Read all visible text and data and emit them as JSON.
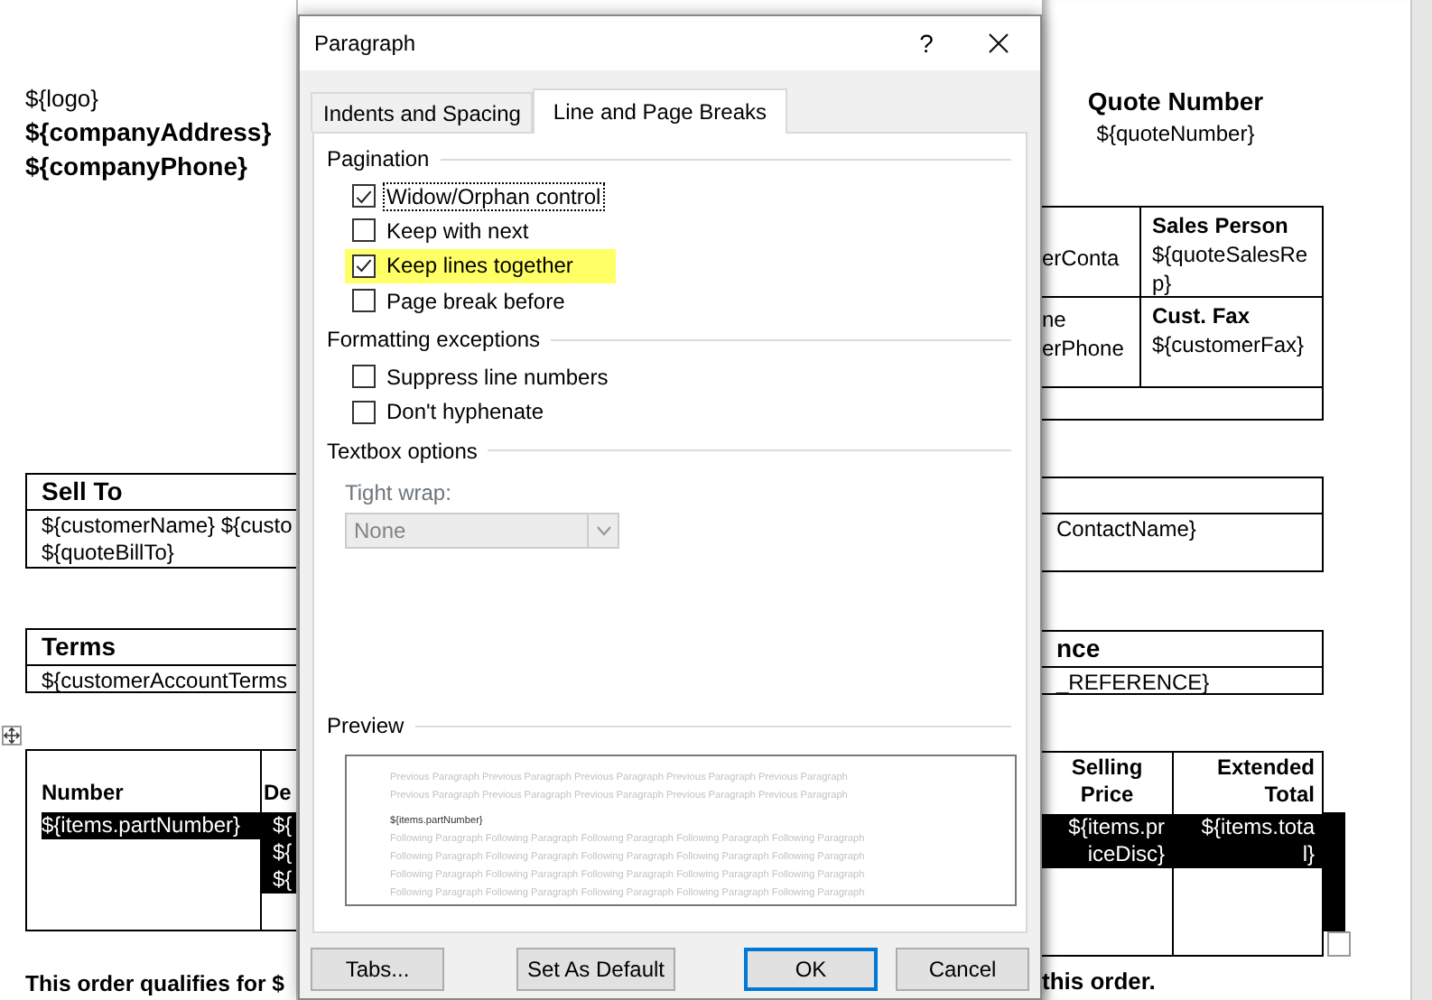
{
  "doc_left": {
    "company": [
      {
        "text": "${logo}",
        "bold": false
      },
      {
        "text": "${companyAddress}",
        "bold": true
      },
      {
        "text": "${companyPhone}",
        "bold": true
      }
    ],
    "sell_to_table": {
      "header": "Sell To",
      "lines": [
        "${customerName}  ${custo",
        "${quoteBillTo}"
      ]
    },
    "terms_table": {
      "header": "Terms",
      "lines": [
        "${customerAccountTerms"
      ]
    },
    "items_table": {
      "columns": [
        "Number",
        "De"
      ],
      "rows": [
        {
          "selected": true,
          "cells": [
            [
              "${items.partNumber}"
            ],
            [
              "${",
              "${",
              "${"
            ]
          ]
        }
      ]
    },
    "footer": "This order qualifies for $"
  },
  "dialog": {
    "title": "Paragraph",
    "help": "?",
    "tabs": [
      {
        "label": "Indents and Spacing",
        "selected": false
      },
      {
        "label": "Line and Page Breaks",
        "selected": true
      }
    ],
    "groups": [
      {
        "title": "Pagination",
        "options": [
          {
            "label": "Widow/Orphan control",
            "checked": true,
            "focused": true,
            "highlighted": false
          },
          {
            "label": "Keep with next",
            "checked": false,
            "focused": false,
            "highlighted": false
          },
          {
            "label": "Keep lines together",
            "checked": true,
            "focused": false,
            "highlighted": true
          },
          {
            "label": "Page break before",
            "checked": false,
            "focused": false,
            "highlighted": false
          }
        ]
      },
      {
        "title": "Formatting exceptions",
        "options": [
          {
            "label": "Suppress line numbers",
            "checked": false,
            "focused": false,
            "highlighted": false
          },
          {
            "label": "Don't hyphenate",
            "checked": false,
            "focused": false,
            "highlighted": false
          }
        ]
      }
    ],
    "textbox_options": {
      "title": "Textbox options",
      "label": "Tight wrap:",
      "value": "None",
      "disabled": true
    },
    "preview": {
      "title": "Preview",
      "previous": [
        "Previous Paragraph Previous Paragraph Previous Paragraph Previous Paragraph Previous Paragraph",
        "Previous Paragraph Previous Paragraph Previous Paragraph Previous Paragraph Previous Paragraph"
      ],
      "current": "${items.partNumber}",
      "following": [
        "Following Paragraph Following Paragraph Following Paragraph Following Paragraph Following Paragraph",
        "Following Paragraph Following Paragraph Following Paragraph Following Paragraph Following Paragraph",
        "Following Paragraph Following Paragraph Following Paragraph Following Paragraph Following Paragraph",
        "Following Paragraph Following Paragraph Following Paragraph Following Paragraph Following Paragraph"
      ]
    },
    "buttons": [
      {
        "label": "Tabs...",
        "default": false
      },
      {
        "label": "Set As Default",
        "default": false
      },
      {
        "label": "OK",
        "default": true
      },
      {
        "label": "Cancel",
        "default": false
      }
    ]
  },
  "doc_right": {
    "quote_title": "Quote Number",
    "quote_number": "${quoteNumber}",
    "info_table": {
      "rows": [
        {
          "cells": [
            {
              "lines": [
                "erConta"
              ]
            },
            {
              "heading": "Sales Person",
              "lines": [
                "${quoteSalesRe",
                "p}"
              ]
            }
          ]
        },
        {
          "cells": [
            {
              "lines": [
                "ne",
                "erPhone"
              ]
            },
            {
              "heading": "Cust. Fax",
              "lines": [
                "${customerFax}"
              ]
            }
          ]
        }
      ]
    },
    "ship_table": {
      "lines": [
        "ContactName}"
      ]
    },
    "reference_table": {
      "header": "nce",
      "lines": [
        "_REFERENCE}"
      ]
    },
    "items_table": {
      "columns": [
        "Selling Price",
        "Extended Total"
      ],
      "rows": [
        {
          "selected": true,
          "cells": [
            [
              "${items.pr",
              "iceDisc}"
            ],
            [
              "${items.tota",
              "l}"
            ]
          ]
        }
      ]
    },
    "footer": "this order."
  }
}
